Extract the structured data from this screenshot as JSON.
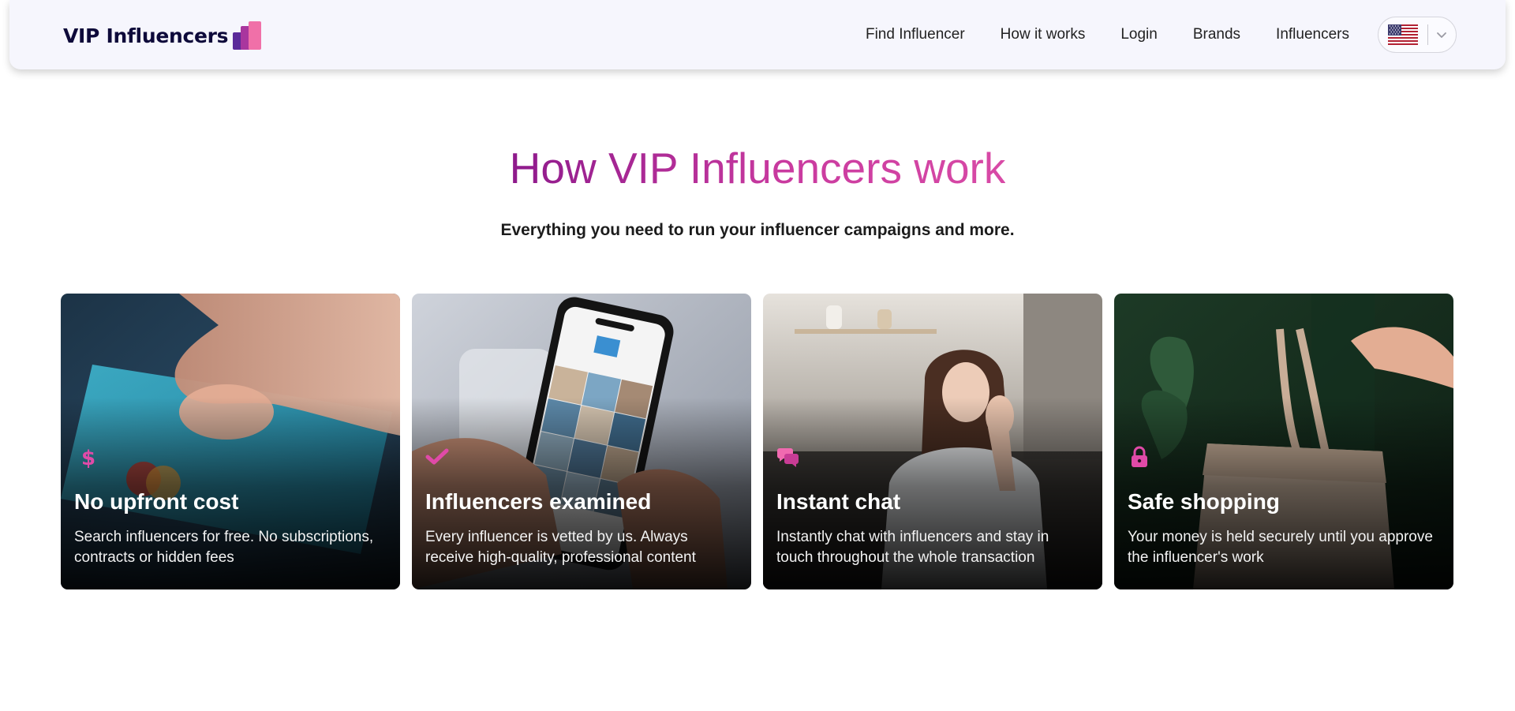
{
  "header": {
    "logo_text": "VIP Influencers",
    "nav": [
      {
        "label": "Find Influencer"
      },
      {
        "label": "How it works"
      },
      {
        "label": "Login"
      },
      {
        "label": "Brands"
      },
      {
        "label": "Influencers"
      }
    ],
    "language": {
      "flag_icon": "us-flag-icon",
      "chevron_icon": "chevron-down-icon"
    }
  },
  "hero": {
    "title": "How VIP Influencers work",
    "subtitle": "Everything you need to run your influencer campaigns and more."
  },
  "cards": [
    {
      "icon": "dollar-icon",
      "title": "No upfront cost",
      "description": "Search influencers for free. No subscriptions, contracts or hidden fees"
    },
    {
      "icon": "checkmark-icon",
      "title": "Influencers examined",
      "description": "Every influencer is vetted by us. Always receive high-quality, professional content"
    },
    {
      "icon": "chat-bubbles-icon",
      "title": "Instant chat",
      "description": "Instantly chat with influencers and stay in touch throughout the whole transaction"
    },
    {
      "icon": "lock-icon",
      "title": "Safe shopping",
      "description": "Your money is held securely until you approve the influencer's work"
    }
  ],
  "colors": {
    "accent_start": "#8e1a8c",
    "accent_end": "#d84aa6",
    "icon_pink": "#e04aa8",
    "header_bg": "#f6f6fd",
    "logo_navy": "#0e0a3a"
  }
}
